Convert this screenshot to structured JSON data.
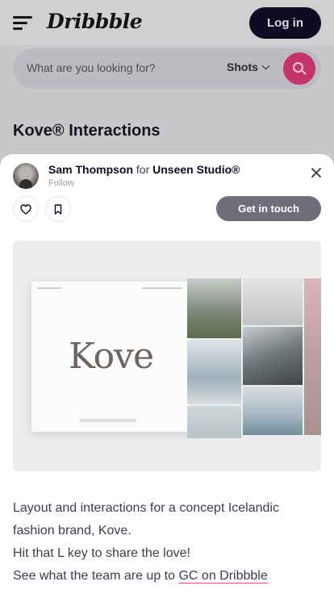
{
  "header": {
    "logo": "Dribbble",
    "login_label": "Log in"
  },
  "search": {
    "placeholder": "What are you looking for?",
    "filter_value": "Shots",
    "accent_color": "#c5336b"
  },
  "shot": {
    "title": "Kove® Interactions"
  },
  "sheet": {
    "author": "Sam Thompson",
    "for_text": "for",
    "team": "Unseen Studio®",
    "follow_label": "Follow",
    "get_in_touch_label": "Get in touch",
    "icons": [
      "heart-icon",
      "bookmark-icon",
      "close-icon"
    ]
  },
  "preview": {
    "wordmark": "Kove"
  },
  "description": {
    "line1": "Layout and interactions for a concept Icelandic fashion brand, Kove.",
    "line2": "Hit that L key to share the love!",
    "line3_prefix": "See what the team are up to ",
    "line3_link": "GC on Dribbble",
    "link_underline_color": "#ea4c89"
  }
}
